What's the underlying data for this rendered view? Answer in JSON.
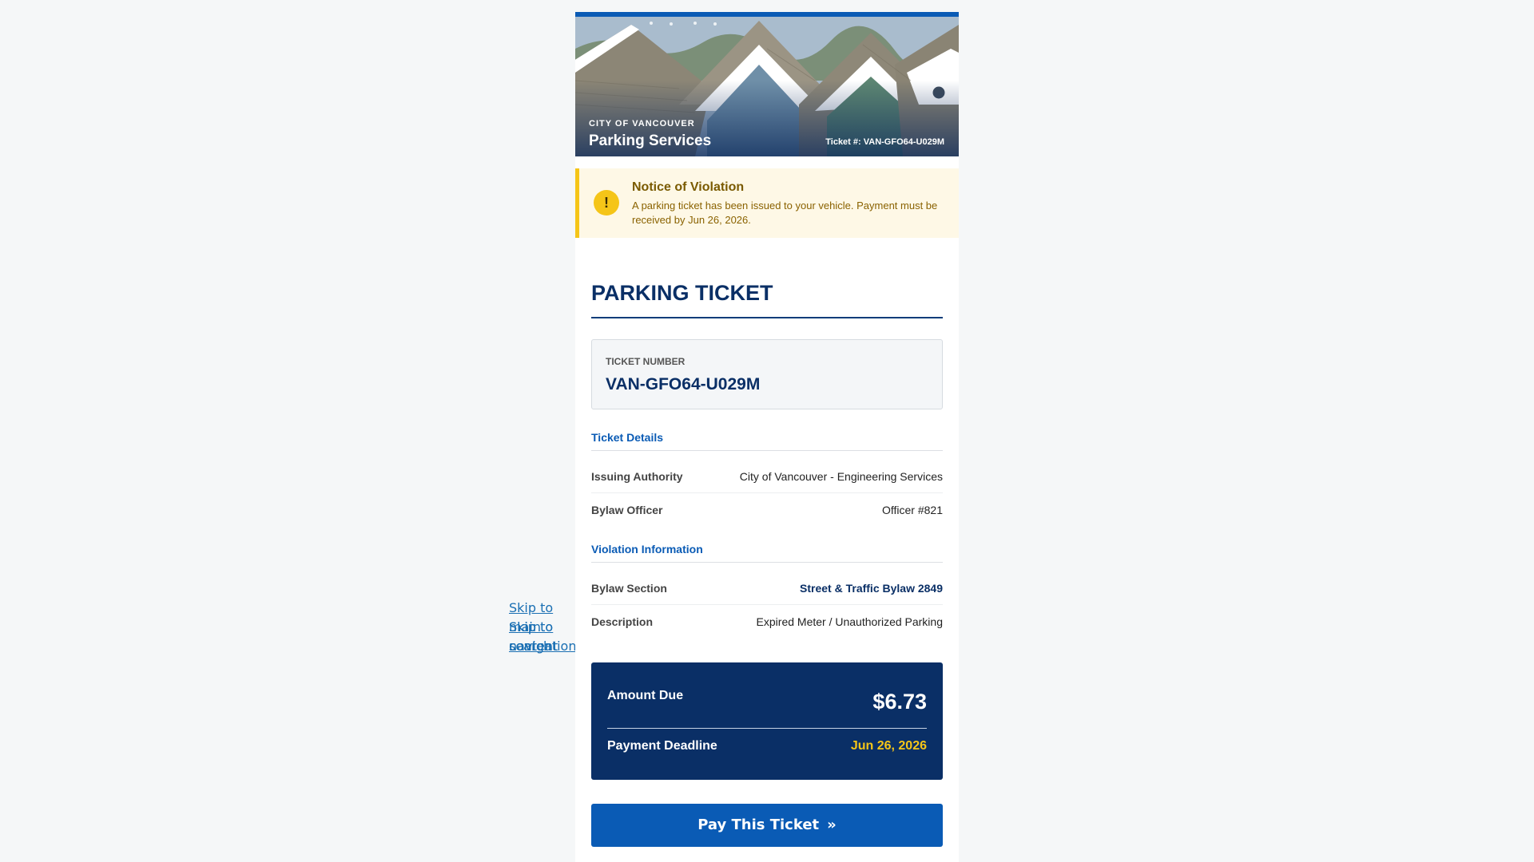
{
  "skip_links": {
    "skip_main": "Skip to main content",
    "skip_search": "Skip to search",
    "skip_nav": "Skip to navigation"
  },
  "header": {
    "city": "CITY OF VANCOUVER",
    "service": "Parking Services",
    "ticket_ref": "Ticket #: VAN-GFO64-U029M"
  },
  "notice": {
    "icon": "!",
    "title": "Notice of Violation",
    "text": "A parking ticket has been issued to your vehicle. Payment must be received by Jun 26, 2026."
  },
  "page_title": "PARKING TICKET",
  "ticket_number": {
    "label": "TICKET NUMBER",
    "value": "VAN-GFO64-U029M"
  },
  "ticket_details": {
    "heading": "Ticket Details",
    "rows": [
      {
        "label": "Issuing Authority",
        "value": "City of Vancouver - Engineering Services"
      },
      {
        "label": "Bylaw Officer",
        "value": "Officer #821"
      }
    ]
  },
  "violation": {
    "heading": "Violation Information",
    "rows": [
      {
        "label": "Bylaw Section",
        "value": "Street & Traffic Bylaw 2849"
      },
      {
        "label": "Description",
        "value": "Expired Meter / Unauthorized Parking"
      }
    ]
  },
  "amount": {
    "label": "Amount Due",
    "value": "$6.73",
    "deadline_label": "Payment Deadline",
    "deadline_value": "Jun 26, 2026"
  },
  "pay_button": {
    "label": "Pay This Ticket",
    "icon": "double-chevron-right-icon"
  },
  "colors": {
    "brand_blue": "#0a5bb5",
    "navy": "#0a2f66",
    "warning_yellow": "#f5c518",
    "notice_bg": "#fef8e6"
  }
}
